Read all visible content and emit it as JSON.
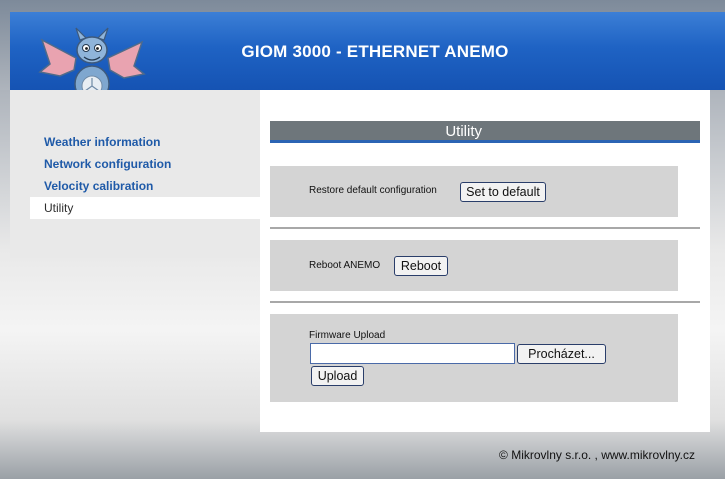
{
  "header": {
    "title": "GIOM 3000 - ETHERNET ANEMO"
  },
  "sidebar": {
    "items": [
      {
        "label": "Weather information"
      },
      {
        "label": "Network configuration"
      },
      {
        "label": "Velocity calibration"
      },
      {
        "label": "Utility",
        "active": true
      }
    ]
  },
  "main": {
    "title": "Utility",
    "restore": {
      "label": "Restore default configuration",
      "button": "Set to default"
    },
    "reboot": {
      "label": "Reboot ANEMO",
      "button": "Reboot"
    },
    "firmware": {
      "label": "Firmware Upload",
      "file_value": "",
      "browse_button": "Procházet...",
      "upload_button": "Upload"
    }
  },
  "footer": {
    "text": "© Mikrovlny s.r.o. , www.mikrovlny.cz"
  },
  "colors": {
    "header_blue": "#1f63c4",
    "title_bar": "#6e767b",
    "nav_link": "#1f5aa8",
    "panel": "#d4d4d4"
  },
  "icons": {
    "logo": "dragon-logo"
  }
}
